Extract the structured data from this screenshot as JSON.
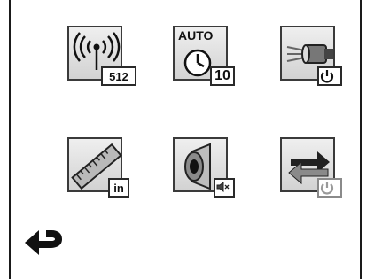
{
  "menu": {
    "signal": {
      "badge": "512"
    },
    "auto": {
      "label": "AUTO",
      "badge": "10"
    },
    "ruler": {
      "badge": "in"
    }
  },
  "icons": {
    "signal": "antenna-signal-icon",
    "auto": "clock-icon",
    "flashlight": "flashlight-icon",
    "ruler": "ruler-icon",
    "speaker": "speaker-icon",
    "rotate": "rotate-arrows-icon",
    "power": "power-icon",
    "mute": "mute-icon",
    "back": "back-arrow-icon"
  }
}
